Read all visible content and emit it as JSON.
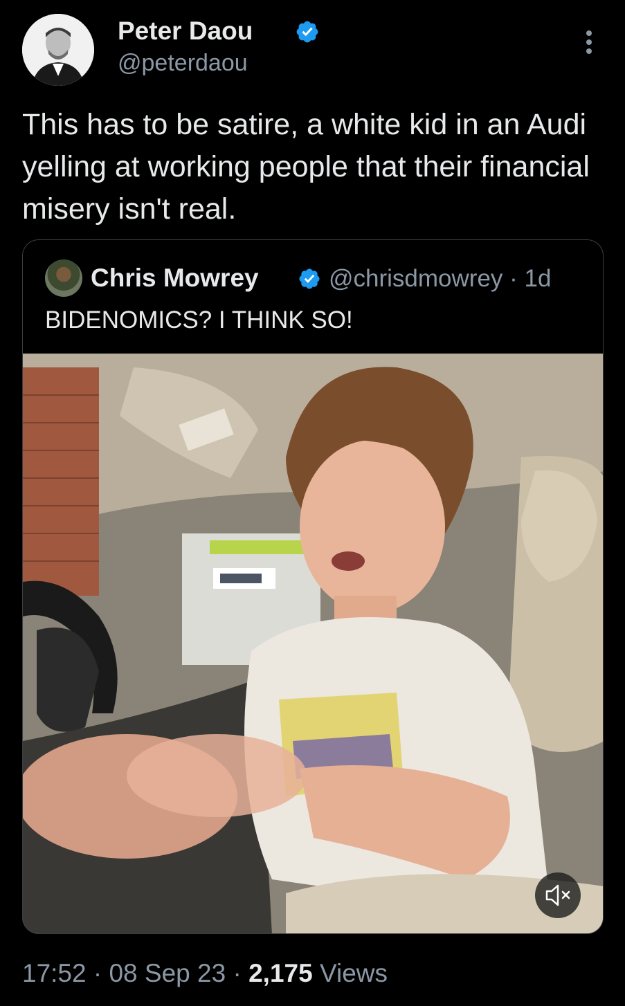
{
  "tweet": {
    "author_name": "Peter Daou",
    "author_handle": "@peterdaou",
    "text": "This has to be satire, a white kid in an Audi yelling at working people that their financial misery isn't real.",
    "time": "17:52",
    "separator": "·",
    "date": "08 Sep 23",
    "views_count": "2,175",
    "views_label": "Views"
  },
  "quoted_tweet": {
    "author_name": "Chris Mowrey",
    "author_handle": "@chrisdmowrey",
    "age": "· 1d",
    "text": "BIDENOMICS? I THINK SO!"
  },
  "icons": {
    "verified": "verified-badge-icon",
    "more": "more-vertical-icon",
    "mute": "volume-muted-icon"
  },
  "colors": {
    "background": "#000000",
    "text": "#e7e9ea",
    "secondary_text": "#8b98a5",
    "verified_blue": "#1d9bf0",
    "border": "#3a3f44"
  }
}
